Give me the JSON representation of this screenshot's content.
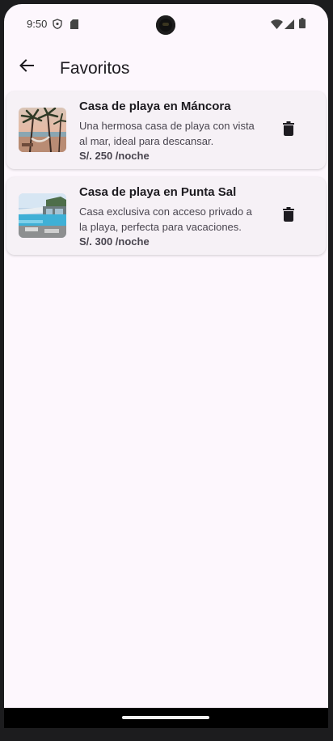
{
  "status_bar": {
    "time": "9:50",
    "left_icons": [
      "shield-icon",
      "sd-card-icon"
    ],
    "right_icons": [
      "wifi-icon",
      "signal-icon",
      "battery-icon"
    ]
  },
  "app_bar": {
    "back_icon": "arrow-back-icon",
    "title": "Favoritos"
  },
  "favorites": [
    {
      "title": "Casa de playa en Máncora",
      "description": "Una hermosa casa de playa con vista al mar, ideal para descansar.",
      "price": "S/. 250 /noche",
      "image": "beach-palms-hammock",
      "delete_icon": "trash-icon"
    },
    {
      "title": "Casa de playa en Punta Sal",
      "description": "Casa exclusiva con acceso privado a la playa, perfecta para vacaciones.",
      "price": "S/. 300 /noche",
      "image": "beach-house-pool",
      "delete_icon": "trash-icon"
    }
  ],
  "colors": {
    "background": "#fdf7fd",
    "card": "#f6f1f6",
    "text_primary": "#1d1b20",
    "text_secondary": "#49454f"
  }
}
